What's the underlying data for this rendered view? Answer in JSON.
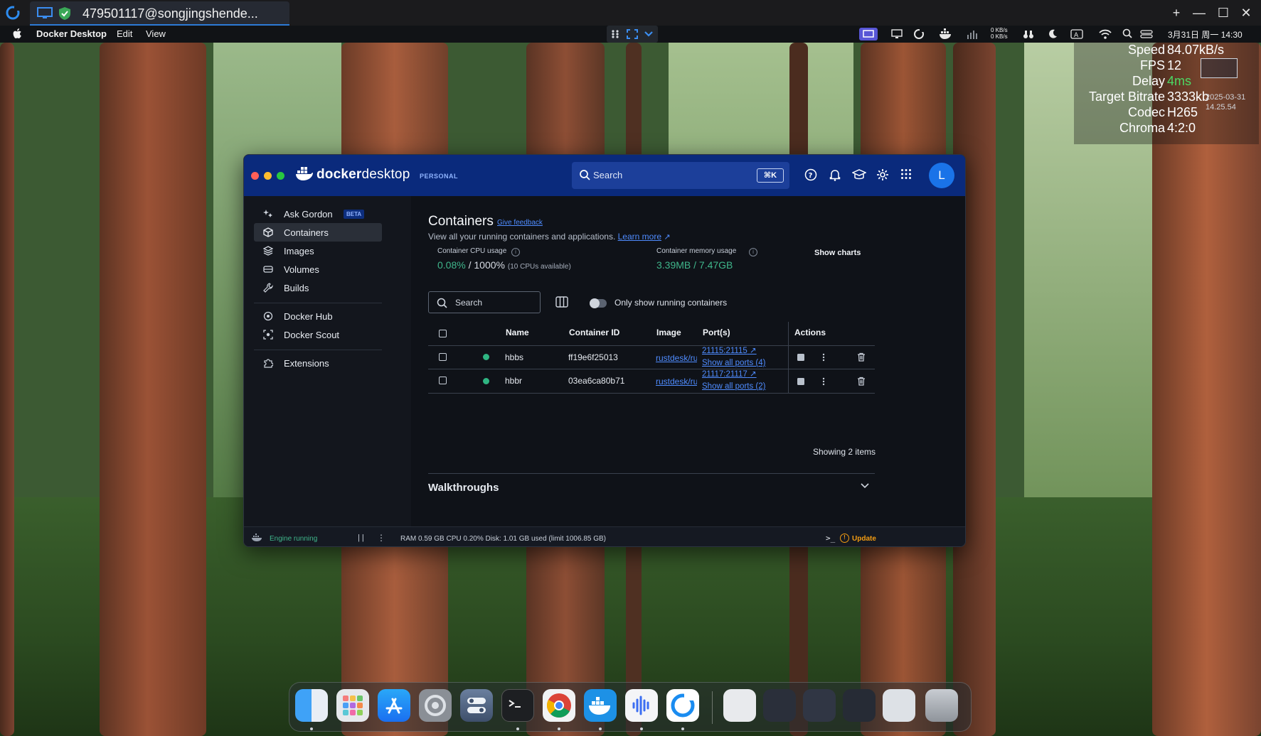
{
  "remote": {
    "tab_title": "479501117@songjingshende...",
    "controls": [
      "+",
      "—",
      "☐",
      "✕"
    ]
  },
  "menubar": {
    "app_name": "Docker Desktop",
    "menus": [
      "Edit",
      "View"
    ],
    "clock": "3月31日 周一 14:30",
    "net_up": "0 KB/s",
    "net_down": "0 KB/s"
  },
  "stats_overlay": {
    "rows": [
      {
        "label": "Speed",
        "value": "84.07kB/s"
      },
      {
        "label": "FPS",
        "value": "12"
      },
      {
        "label": "Delay",
        "value": "4ms"
      },
      {
        "label": "Target Bitrate",
        "value": "3333kb"
      },
      {
        "label": "Codec",
        "value": "H265"
      },
      {
        "label": "Chroma",
        "value": "4:2:0"
      }
    ],
    "date": "2025-03-31",
    "time": "14.25.54"
  },
  "docker": {
    "brand_a": "docker",
    "brand_b": "desktop",
    "plan": "PERSONAL",
    "search_placeholder": "Search",
    "search_shortcut": "⌘K",
    "avatar_letter": "L",
    "nav": {
      "ask_gordon": "Ask Gordon",
      "beta": "BETA",
      "containers": "Containers",
      "images": "Images",
      "volumes": "Volumes",
      "builds": "Builds",
      "docker_hub": "Docker Hub",
      "docker_scout": "Docker Scout",
      "extensions": "Extensions"
    },
    "page": {
      "title": "Containers",
      "feedback": "Give feedback",
      "subtitle": "View all your running containers and applications.",
      "learn_more": "Learn more",
      "cpu_label": "Container CPU usage",
      "cpu_used": "0.08%",
      "cpu_total": "/ 1000%",
      "cpu_note": "(10 CPUs available)",
      "mem_label": "Container memory usage",
      "mem_value": "3.39MB / 7.47GB",
      "show_charts": "Show charts",
      "table_search_placeholder": "Search",
      "only_running": "Only show running containers",
      "showing": "Showing 2 items",
      "walkthroughs": "Walkthroughs"
    },
    "table": {
      "headers": {
        "name": "Name",
        "id": "Container ID",
        "image": "Image",
        "ports": "Port(s)",
        "actions": "Actions"
      },
      "rows": [
        {
          "name": "hbbs",
          "id": "ff19e6f25013",
          "image": "rustdesk/rustdesk-server",
          "port": "21115:21115",
          "all_ports": "Show all ports (4)"
        },
        {
          "name": "hbbr",
          "id": "03ea6ca80b71",
          "image": "rustdesk/rustdesk-server",
          "port": "21117:21117",
          "all_ports": "Show all ports (2)"
        }
      ]
    },
    "footer": {
      "engine": "Engine running",
      "resources": "RAM 0.59 GB   CPU 0.20%    Disk: 1.01 GB used (limit 1006.85 GB)",
      "update": "Update"
    }
  },
  "dock": {
    "apps": [
      "finder-icon",
      "launchpad-icon",
      "app-store-icon",
      "system-settings-icon",
      "finder-alt-icon",
      "terminal-icon",
      "chrome-icon",
      "docker-icon",
      "voice-memos-icon",
      "rustdesk-icon",
      "preview-icon",
      "stack-1-icon",
      "stack-2-icon",
      "stack-3-icon",
      "stack-4-icon",
      "trash-icon"
    ]
  },
  "colors": {
    "docker_header": "#0a2a7c",
    "accent": "#4f8cff",
    "running": "#2fb582",
    "update": "#f39c12"
  }
}
